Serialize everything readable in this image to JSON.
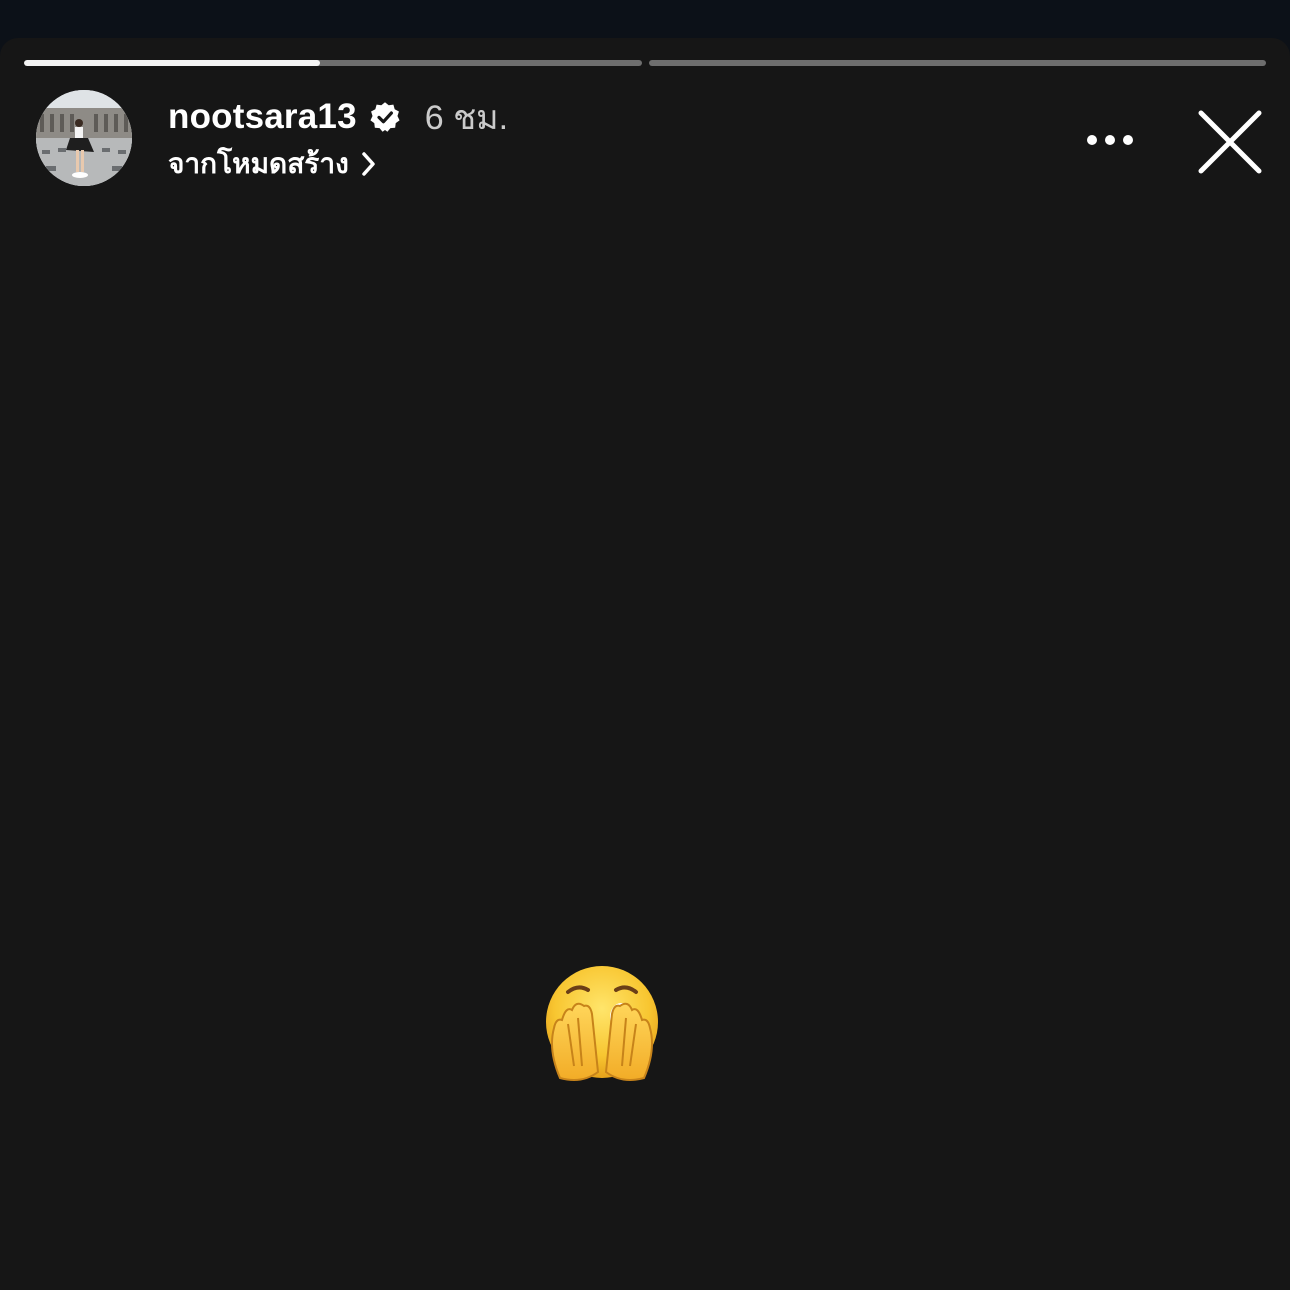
{
  "story": {
    "progress": [
      {
        "filled": 0.48
      },
      {
        "filled": 0.0
      }
    ],
    "username": "nootsara13",
    "time": "6 ชม.",
    "source_label": "จากโหมดสร้าง"
  },
  "icons": {
    "verified": "verified-badge-icon",
    "chevron": "chevron-right-icon",
    "more": "more-options-icon",
    "close": "close-icon",
    "sticker": "face-covering-eyes-emoji"
  },
  "colors": {
    "background": "#161616",
    "verified": "#ffffff",
    "sticker_yellow": "#f7c531"
  }
}
